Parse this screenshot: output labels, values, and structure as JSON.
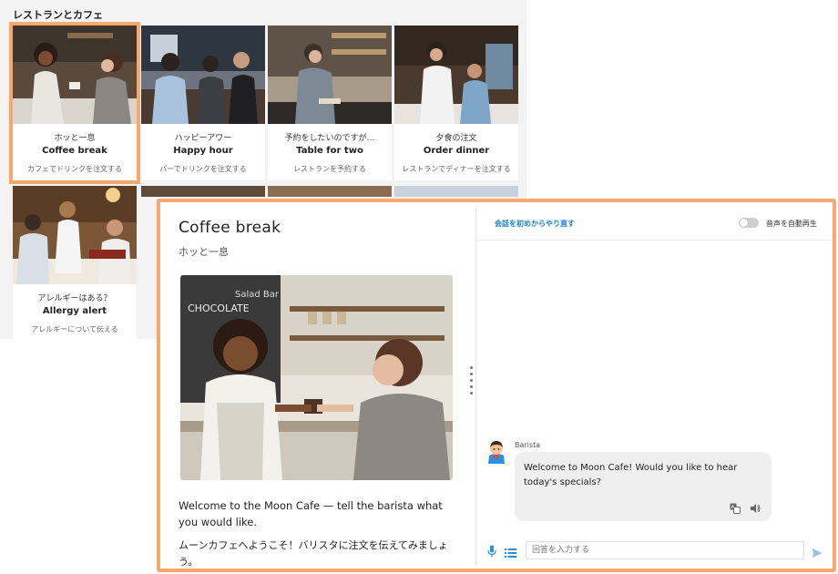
{
  "section": {
    "title": "レストランとカフェ"
  },
  "cards": [
    {
      "jp": "ホッと一息",
      "en": "Coffee break",
      "desc": "カフェでドリンクを注文する"
    },
    {
      "jp": "ハッピーアワー",
      "en": "Happy hour",
      "desc": "バーでドリンクを注文する"
    },
    {
      "jp": "予約をしたいのですが…",
      "en": "Table for two",
      "desc": "レストランを予約する"
    },
    {
      "jp": "夕食の注文",
      "en": "Order dinner",
      "desc": "レストランでディナーを注文する"
    },
    {
      "jp": "アレルギーはある？",
      "en": "Allergy alert",
      "desc": "アレルギーについて伝える"
    }
  ],
  "dialog": {
    "title": "Coffee break",
    "subtitle": "ホッと一息",
    "text_en": "Welcome to the Moon Cafe — tell the barista what you would like.",
    "text_jp": "ムーンカフェへようこそ！バリスタに注文を伝えてみましょう。"
  },
  "chat": {
    "restart_label": "会話を初めからやり直す",
    "autoplay_label": "音声を自動再生",
    "speaker": "Barista",
    "message": "Welcome to Moon Cafe! Would you like to hear today's specials?",
    "input_placeholder": "回答を入力する"
  },
  "icons": {
    "translate": "translate-icon",
    "speaker": "speaker-icon",
    "mic": "microphone-icon",
    "list": "list-icon",
    "send": "send-icon"
  },
  "colors": {
    "accent_orange": "#f7a86e",
    "link_blue": "#1a7fd1",
    "icon_blue": "#2b8fe0",
    "bubble_gray": "#efefef"
  }
}
